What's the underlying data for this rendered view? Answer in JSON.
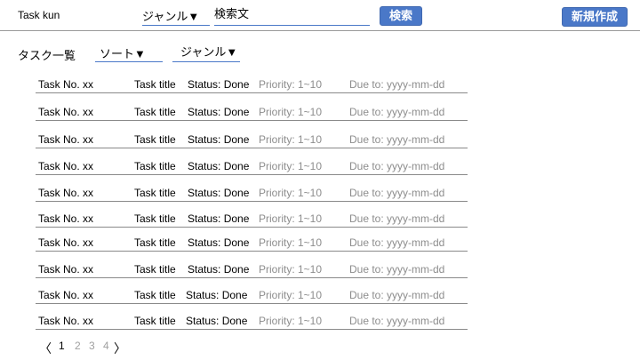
{
  "header": {
    "app_title": "Task kun",
    "genre_label": "ジャンル▼",
    "search_placeholder": "検索文",
    "search_button": "検索",
    "new_button": "新規作成"
  },
  "list": {
    "title": "タスク一覧",
    "sort_label": "ソート▼",
    "genre_label": "ジャンル▼"
  },
  "tasks": [
    {
      "no": "Task No. xx",
      "title": "Task title",
      "status": "Status: Done",
      "priority": "Priority: 1~10",
      "due": "Due to: yyyy-mm-dd"
    },
    {
      "no": "Task No. xx",
      "title": "Task title",
      "status": "Status: Done",
      "priority": "Priority: 1~10",
      "due": "Due to: yyyy-mm-dd"
    },
    {
      "no": "Task No. xx",
      "title": "Task title",
      "status": "Status: Done",
      "priority": "Priority: 1~10",
      "due": "Due to: yyyy-mm-dd"
    },
    {
      "no": "Task No. xx",
      "title": "Task title",
      "status": "Status: Done",
      "priority": "Priority: 1~10",
      "due": "Due to: yyyy-mm-dd"
    },
    {
      "no": "Task No. xx",
      "title": "Task title",
      "status": "Status: Done",
      "priority": "Priority: 1~10",
      "due": "Due to: yyyy-mm-dd"
    },
    {
      "no": "Task No. xx",
      "title": "Task title",
      "status": "Status: Done",
      "priority": "Priority: 1~10",
      "due": "Due to: yyyy-mm-dd"
    },
    {
      "no": "Task No. xx",
      "title": "Task title",
      "status": "Status: Done",
      "priority": "Priority: 1~10",
      "due": "Due to: yyyy-mm-dd"
    },
    {
      "no": "Task No. xx",
      "title": "Task title",
      "status": "Status: Done",
      "priority": "Priority: 1~10",
      "due": "Due to: yyyy-mm-dd"
    },
    {
      "no": "Task No. xx",
      "title": "Task title",
      "status": "Status: Done",
      "priority": "Priority: 1~10",
      "due": "Due to: yyyy-mm-dd"
    },
    {
      "no": "Task No. xx",
      "title": "Task title",
      "status": "Status: Done",
      "priority": "Priority: 1~10",
      "due": "Due to: yyyy-mm-dd"
    }
  ],
  "pagination": {
    "prev_icon": "chevron-left-icon",
    "next_icon": "chevron-right-icon",
    "prev_glyph": "〈",
    "next_glyph": "〉",
    "pages": [
      "1",
      "2",
      "3",
      "4"
    ],
    "current_page": "1"
  },
  "colors": {
    "accent": "#4a78c8",
    "secondary_text": "#8d8d8d",
    "inactive_page": "#a0a0a0"
  }
}
